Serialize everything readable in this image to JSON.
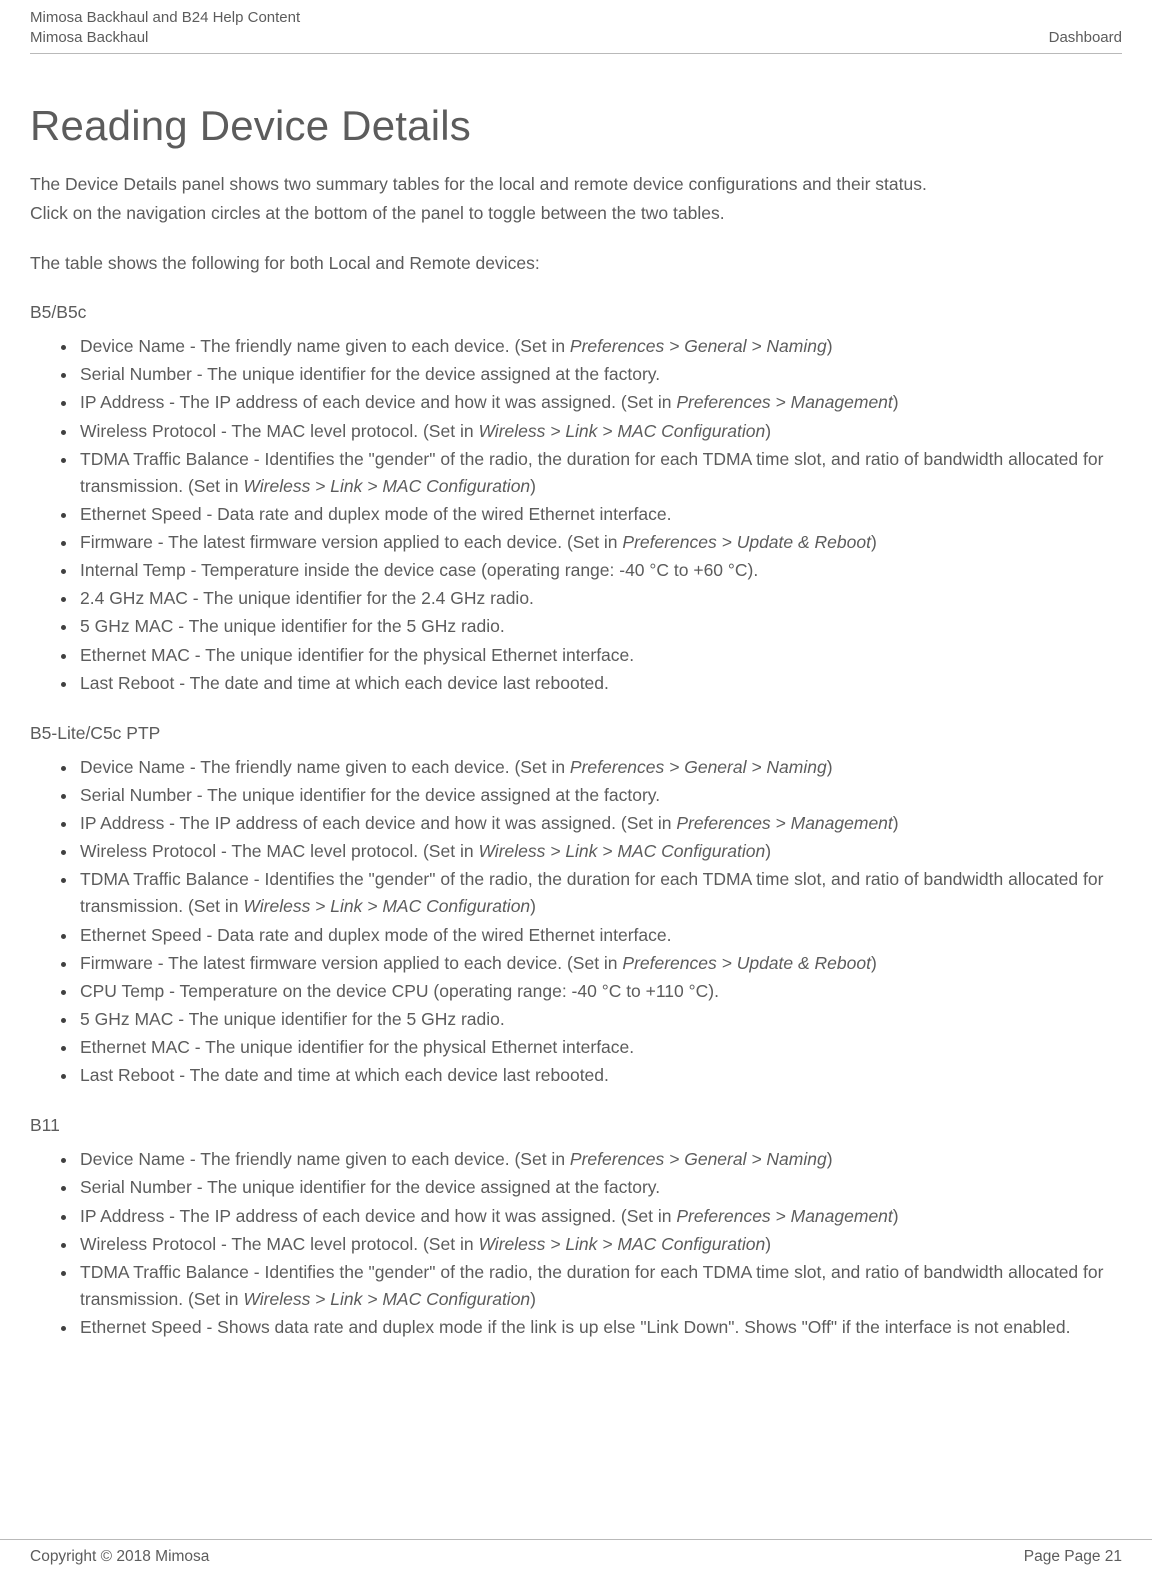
{
  "header": {
    "line1": "Mimosa Backhaul and B24 Help Content",
    "line2_left": "Mimosa Backhaul",
    "line2_right": "Dashboard"
  },
  "title": "Reading Device Details",
  "intro": [
    "The Device Details panel shows two summary tables for the local and remote device configurations and their status.",
    "Click on the navigation circles at the bottom of the panel to toggle between the two tables.",
    "The table shows the following for both Local and Remote devices:"
  ],
  "sections": [
    {
      "label": "B5/B5c",
      "items": [
        {
          "plain": "Device Name - The friendly name given to each device. (Set in ",
          "path": "Preferences > General > Naming",
          "tail": ")"
        },
        {
          "plain": "Serial Number - The unique identifier for the device assigned at the factory.",
          "path": "",
          "tail": ""
        },
        {
          "plain": "IP Address - The IP address of each device and how it was assigned. (Set in ",
          "path": "Preferences > Management",
          "tail": ")"
        },
        {
          "plain": "Wireless Protocol - The MAC level protocol. (Set in ",
          "path": "Wireless > Link > MAC Configuration",
          "tail": ")"
        },
        {
          "plain": "TDMA Traffic Balance - Identifies the \"gender\" of the radio, the duration for each TDMA time slot, and ratio of bandwidth allocated for transmission. (Set in ",
          "path": "Wireless > Link > MAC Configuration",
          "tail": ")"
        },
        {
          "plain": "Ethernet Speed - Data rate and duplex mode of the wired Ethernet interface.",
          "path": "",
          "tail": ""
        },
        {
          "plain": "Firmware - The latest firmware version applied to each device. (Set in ",
          "path": "Preferences > Update & Reboot",
          "tail": ")"
        },
        {
          "plain": "Internal Temp - Temperature inside the device case  (operating range: -40 °C to +60 °C).",
          "path": "",
          "tail": ""
        },
        {
          "plain": "2.4 GHz MAC - The unique identifier for the 2.4 GHz radio.",
          "path": "",
          "tail": ""
        },
        {
          "plain": "5 GHz MAC - The unique identifier for the 5 GHz radio.",
          "path": "",
          "tail": ""
        },
        {
          "plain": "Ethernet MAC - The unique identifier for the physical Ethernet interface.",
          "path": "",
          "tail": ""
        },
        {
          "plain": "Last Reboot - The date and time at which each device last rebooted.",
          "path": "",
          "tail": ""
        }
      ]
    },
    {
      "label": "B5-Lite/C5c PTP",
      "items": [
        {
          "plain": "Device Name - The friendly name given to each device. (Set in ",
          "path": "Preferences > General > Naming",
          "tail": ")"
        },
        {
          "plain": "Serial Number - The unique identifier for the device assigned at the factory.",
          "path": "",
          "tail": ""
        },
        {
          "plain": "IP Address - The IP address of each device and how it was assigned. (Set in ",
          "path": "Preferences > Management",
          "tail": ")"
        },
        {
          "plain": "Wireless Protocol - The MAC level protocol. (Set in ",
          "path": "Wireless > Link > MAC Configuration",
          "tail": ")"
        },
        {
          "plain": "TDMA Traffic Balance - Identifies the \"gender\" of the radio, the duration for each TDMA time slot, and ratio of bandwidth allocated for transmission. (Set in ",
          "path": "Wireless > Link > MAC Configuration",
          "tail": ")"
        },
        {
          "plain": "Ethernet Speed - Data rate and duplex mode of the wired Ethernet interface.",
          "path": "",
          "tail": ""
        },
        {
          "plain": "Firmware - The latest firmware version applied to each device. (Set in ",
          "path": "Preferences > Update & Reboot",
          "tail": ")"
        },
        {
          "plain": "CPU Temp - Temperature on the device CPU (operating range: -40 °C to +110 °C).",
          "path": "",
          "tail": ""
        },
        {
          "plain": "5 GHz MAC - The unique identifier for the 5 GHz radio.",
          "path": "",
          "tail": ""
        },
        {
          "plain": "Ethernet MAC - The unique identifier for the physical Ethernet interface.",
          "path": "",
          "tail": ""
        },
        {
          "plain": "Last Reboot - The date and time at which each device last rebooted.",
          "path": "",
          "tail": ""
        }
      ]
    },
    {
      "label": "B11",
      "items": [
        {
          "plain": "Device Name - The friendly name given to each device. (Set in ",
          "path": "Preferences > General > Naming",
          "tail": ")"
        },
        {
          "plain": "Serial Number - The unique identifier for the device assigned at the factory.",
          "path": "",
          "tail": ""
        },
        {
          "plain": "IP Address - The IP address of each device and how it was assigned. (Set in ",
          "path": "Preferences > Management",
          "tail": ")"
        },
        {
          "plain": "Wireless Protocol - The MAC level protocol. (Set in ",
          "path": "Wireless > Link > MAC Configuration",
          "tail": ")"
        },
        {
          "plain": "TDMA Traffic Balance - Identifies the \"gender\" of the radio, the duration for each TDMA time slot, and ratio of bandwidth allocated for transmission. (Set in ",
          "path": "Wireless > Link > MAC Configuration",
          "tail": ")"
        },
        {
          "plain": "Ethernet Speed - Shows data rate and duplex mode if the link is up else \"Link Down\". Shows \"Off\" if the interface is not enabled.",
          "path": "",
          "tail": ""
        }
      ]
    }
  ],
  "footer": {
    "left": "Copyright © 2018 Mimosa",
    "right": "Page Page 21"
  }
}
